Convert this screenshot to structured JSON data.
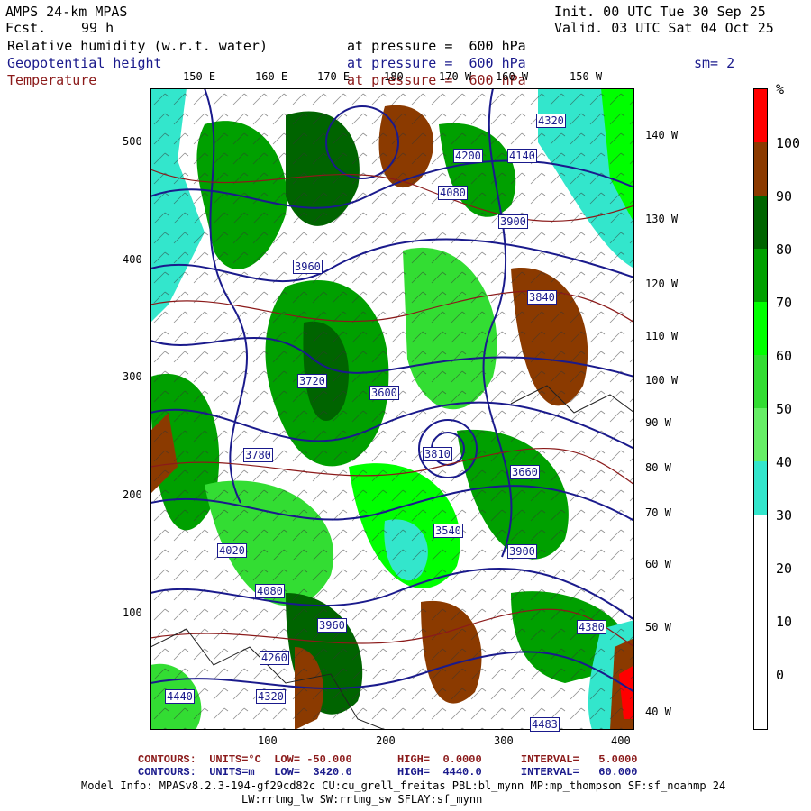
{
  "header": {
    "model": "AMPS 24-km MPAS",
    "fcst_label": "Fcst.",
    "fcst_value": "99 h",
    "init": "Init. 00 UTC Tue 30 Sep 25",
    "valid": "Valid. 03 UTC Sat 04 Oct 25",
    "field1": "Relative humidity (w.r.t. water)",
    "field1_level": "at pressure =  600 hPa",
    "field2": "Geopotential height",
    "field2_level": "at pressure =  600 hPa",
    "sm": "sm= 2",
    "field3": "Temperature",
    "field3_level": "at pressure =  600 hPa"
  },
  "colors": {
    "rh_blue": "#1a1a8c",
    "temp_red": "#8b1a1a",
    "land": "#333333"
  },
  "map": {
    "top_lon_labels": [
      "150 E",
      "160 E",
      "170 E",
      "180",
      "170 W",
      "160 W",
      "150 W"
    ],
    "right_lon_labels": [
      "140 W",
      "130 W",
      "120 W",
      "110 W",
      "100 W",
      "90 W",
      "80 W",
      "70 W",
      "60 W",
      "50 W",
      "40 W"
    ],
    "left_y_ticks": [
      "500",
      "400",
      "300",
      "200",
      "100"
    ],
    "bottom_x_ticks": [
      "100",
      "200",
      "300",
      "400"
    ],
    "height_labels": [
      "4320",
      "4140",
      "4200",
      "4080",
      "3900",
      "3960",
      "3840",
      "3600",
      "3810",
      "3660",
      "3540",
      "3780",
      "4020",
      "4260",
      "4440",
      "4380",
      "4483",
      "4320",
      "4080",
      "3960",
      "3900",
      "3720"
    ]
  },
  "colorbar": {
    "unit": "%",
    "labels": [
      "100",
      "90",
      "80",
      "70",
      "60",
      "50",
      "40",
      "30",
      "20",
      "10",
      "0"
    ],
    "colors": [
      "#ff0000",
      "#8b3a00",
      "#006400",
      "#00a000",
      "#00ff00",
      "#33dd33",
      "#66ee66",
      "#33e6cc",
      "#ffffff",
      "#ffffff",
      "#ffffff"
    ]
  },
  "footer": {
    "line1": "CONTOURS:  UNITS=°C  LOW= -50.000       HIGH=  0.0000      INTERVAL=   5.0000",
    "line2": "CONTOURS:  UNITS=m   LOW=  3420.0       HIGH=  4440.0      INTERVAL=   60.000",
    "line3": "Model Info: MPASv8.2.3-194-gf29cd82c CU:cu_grell_freitas PBL:bl_mynn MP:mp_thompson SF:sf_noahmp 24",
    "line4": "LW:rrtmg_lw SW:rrtmg_sw SFLAY:sf_mynn"
  }
}
